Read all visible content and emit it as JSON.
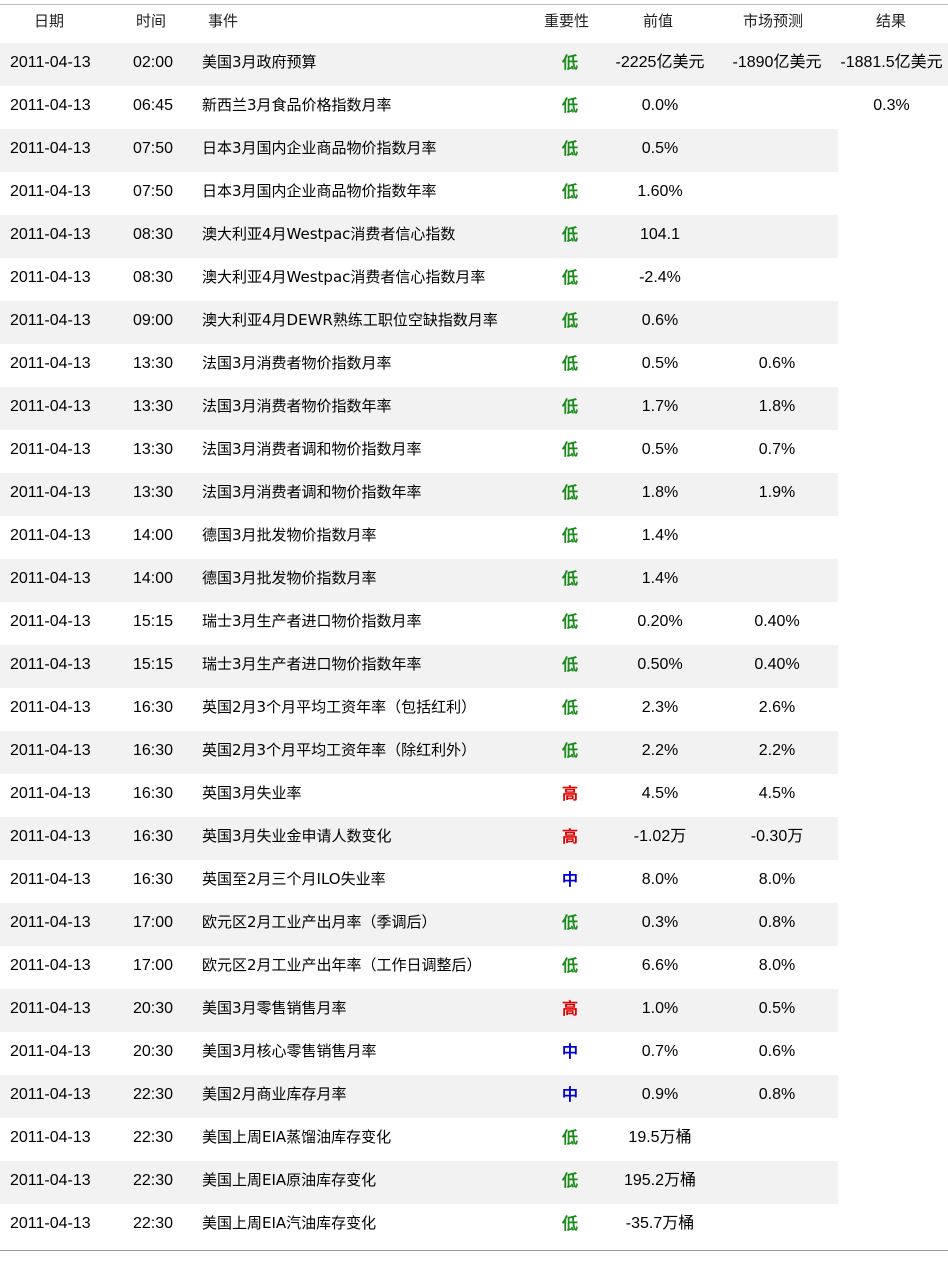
{
  "header": {
    "date": "日期",
    "time": "时间",
    "event": "事件",
    "importance": "重要性",
    "previous": "前值",
    "forecast": "市场预测",
    "result": "结果"
  },
  "colors": {
    "low": "#1a8a1a",
    "high": "#e00000",
    "medium": "#0000cc"
  },
  "rows": [
    {
      "date": "2011-04-13",
      "time": "02:00",
      "event": "美国3月政府预算",
      "importance": "低",
      "level": "low",
      "previous": "-2225亿美元",
      "forecast": "-1890亿美元",
      "result": "-1881.5亿美元"
    },
    {
      "date": "2011-04-13",
      "time": "06:45",
      "event": "新西兰3月食品价格指数月率",
      "importance": "低",
      "level": "low",
      "previous": "0.0%",
      "forecast": "",
      "result": "0.3%"
    },
    {
      "date": "2011-04-13",
      "time": "07:50",
      "event": "日本3月国内企业商品物价指数月率",
      "importance": "低",
      "level": "low",
      "previous": "0.5%",
      "forecast": "",
      "result": ""
    },
    {
      "date": "2011-04-13",
      "time": "07:50",
      "event": "日本3月国内企业商品物价指数年率",
      "importance": "低",
      "level": "low",
      "previous": "1.60%",
      "forecast": "",
      "result": ""
    },
    {
      "date": "2011-04-13",
      "time": "08:30",
      "event": "澳大利亚4月Westpac消费者信心指数",
      "importance": "低",
      "level": "low",
      "previous": "104.1",
      "forecast": "",
      "result": ""
    },
    {
      "date": "2011-04-13",
      "time": "08:30",
      "event": "澳大利亚4月Westpac消费者信心指数月率",
      "importance": "低",
      "level": "low",
      "previous": "-2.4%",
      "forecast": "",
      "result": ""
    },
    {
      "date": "2011-04-13",
      "time": "09:00",
      "event": "澳大利亚4月DEWR熟练工职位空缺指数月率",
      "importance": "低",
      "level": "low",
      "previous": "0.6%",
      "forecast": "",
      "result": ""
    },
    {
      "date": "2011-04-13",
      "time": "13:30",
      "event": "法国3月消费者物价指数月率",
      "importance": "低",
      "level": "low",
      "previous": "0.5%",
      "forecast": "0.6%",
      "result": ""
    },
    {
      "date": "2011-04-13",
      "time": "13:30",
      "event": "法国3月消费者物价指数年率",
      "importance": "低",
      "level": "low",
      "previous": "1.7%",
      "forecast": "1.8%",
      "result": ""
    },
    {
      "date": "2011-04-13",
      "time": "13:30",
      "event": "法国3月消费者调和物价指数月率",
      "importance": "低",
      "level": "low",
      "previous": "0.5%",
      "forecast": "0.7%",
      "result": ""
    },
    {
      "date": "2011-04-13",
      "time": "13:30",
      "event": "法国3月消费者调和物价指数年率",
      "importance": "低",
      "level": "low",
      "previous": "1.8%",
      "forecast": "1.9%",
      "result": ""
    },
    {
      "date": "2011-04-13",
      "time": "14:00",
      "event": "德国3月批发物价指数月率",
      "importance": "低",
      "level": "low",
      "previous": "1.4%",
      "forecast": "",
      "result": ""
    },
    {
      "date": "2011-04-13",
      "time": "14:00",
      "event": "德国3月批发物价指数月率",
      "importance": "低",
      "level": "low",
      "previous": "1.4%",
      "forecast": "",
      "result": ""
    },
    {
      "date": "2011-04-13",
      "time": "15:15",
      "event": "瑞士3月生产者进口物价指数月率",
      "importance": "低",
      "level": "low",
      "previous": "0.20%",
      "forecast": "0.40%",
      "result": ""
    },
    {
      "date": "2011-04-13",
      "time": "15:15",
      "event": "瑞士3月生产者进口物价指数年率",
      "importance": "低",
      "level": "low",
      "previous": "0.50%",
      "forecast": "0.40%",
      "result": ""
    },
    {
      "date": "2011-04-13",
      "time": "16:30",
      "event": "英国2月3个月平均工资年率（包括红利）",
      "importance": "低",
      "level": "low",
      "previous": "2.3%",
      "forecast": "2.6%",
      "result": ""
    },
    {
      "date": "2011-04-13",
      "time": "16:30",
      "event": "英国2月3个月平均工资年率（除红利外）",
      "importance": "低",
      "level": "low",
      "previous": "2.2%",
      "forecast": "2.2%",
      "result": ""
    },
    {
      "date": "2011-04-13",
      "time": "16:30",
      "event": "英国3月失业率",
      "importance": "高",
      "level": "high",
      "previous": "4.5%",
      "forecast": "4.5%",
      "result": ""
    },
    {
      "date": "2011-04-13",
      "time": "16:30",
      "event": "英国3月失业金申请人数变化",
      "importance": "高",
      "level": "high",
      "previous": "-1.02万",
      "forecast": "-0.30万",
      "result": ""
    },
    {
      "date": "2011-04-13",
      "time": "16:30",
      "event": "英国至2月三个月ILO失业率",
      "importance": "中",
      "level": "medium",
      "previous": "8.0%",
      "forecast": "8.0%",
      "result": ""
    },
    {
      "date": "2011-04-13",
      "time": "17:00",
      "event": "欧元区2月工业产出月率（季调后）",
      "importance": "低",
      "level": "low",
      "previous": "0.3%",
      "forecast": "0.8%",
      "result": ""
    },
    {
      "date": "2011-04-13",
      "time": "17:00",
      "event": "欧元区2月工业产出年率（工作日调整后）",
      "importance": "低",
      "level": "low",
      "previous": "6.6%",
      "forecast": "8.0%",
      "result": ""
    },
    {
      "date": "2011-04-13",
      "time": "20:30",
      "event": "美国3月零售销售月率",
      "importance": "高",
      "level": "high",
      "previous": "1.0%",
      "forecast": "0.5%",
      "result": ""
    },
    {
      "date": "2011-04-13",
      "time": "20:30",
      "event": "美国3月核心零售销售月率",
      "importance": "中",
      "level": "medium",
      "previous": "0.7%",
      "forecast": "0.6%",
      "result": ""
    },
    {
      "date": "2011-04-13",
      "time": "22:30",
      "event": "美国2月商业库存月率",
      "importance": "中",
      "level": "medium",
      "previous": "0.9%",
      "forecast": "0.8%",
      "result": ""
    },
    {
      "date": "2011-04-13",
      "time": "22:30",
      "event": "美国上周EIA蒸馏油库存变化",
      "importance": "低",
      "level": "low",
      "previous": "19.5万桶",
      "forecast": "",
      "result": ""
    },
    {
      "date": "2011-04-13",
      "time": "22:30",
      "event": "美国上周EIA原油库存变化",
      "importance": "低",
      "level": "low",
      "previous": "195.2万桶",
      "forecast": "",
      "result": ""
    },
    {
      "date": "2011-04-13",
      "time": "22:30",
      "event": "美国上周EIA汽油库存变化",
      "importance": "低",
      "level": "low",
      "previous": "-35.7万桶",
      "forecast": "",
      "result": ""
    }
  ]
}
